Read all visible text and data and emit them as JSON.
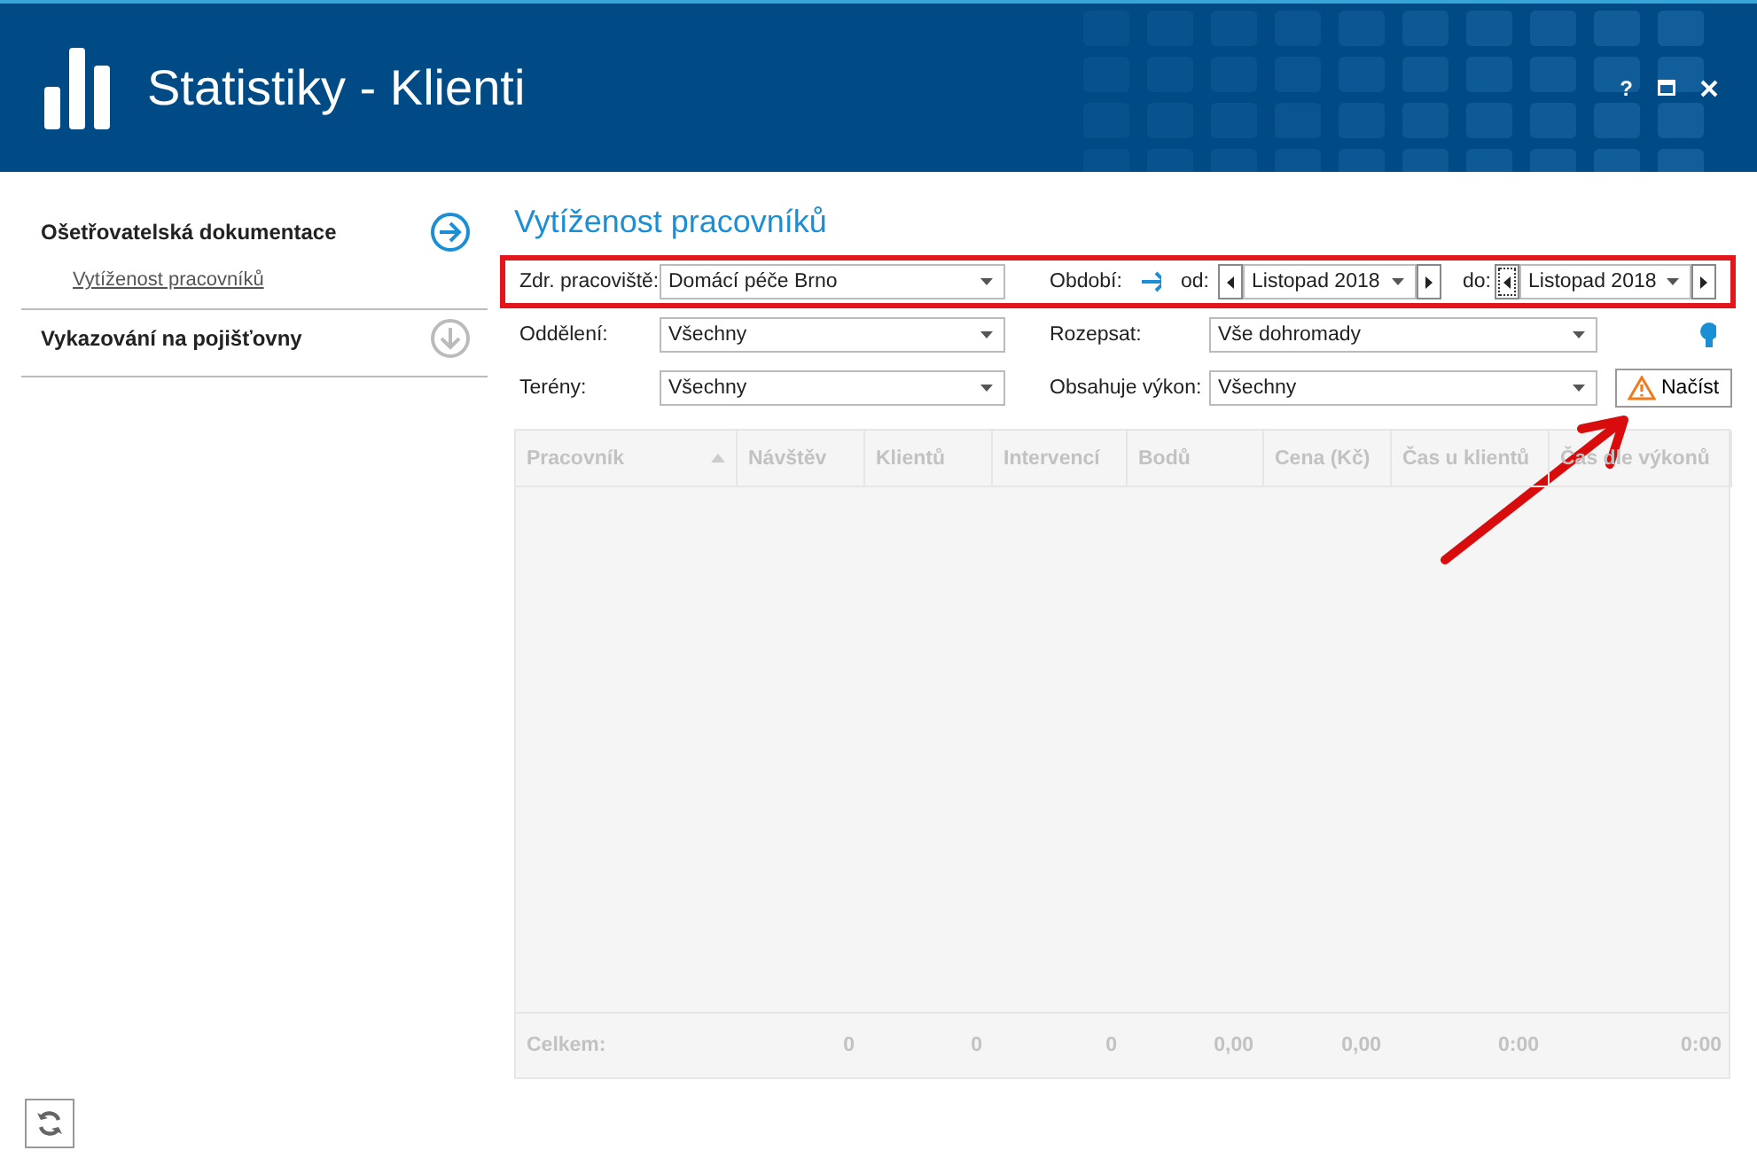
{
  "window": {
    "title": "Statistiky - Klienti",
    "help": "?"
  },
  "sidebar": {
    "sections": [
      {
        "title": "Ošetřovatelská dokumentace",
        "active": true,
        "items": [
          {
            "label": "Vytíženost pracovníků"
          }
        ]
      },
      {
        "title": "Vykazování na pojišťovny",
        "active": false
      }
    ]
  },
  "page_title": "Vytíženost pracovníků",
  "filter_rows": [
    {
      "highlighted": true,
      "fields": [
        {
          "kind": "select",
          "label": "Zdr. pracoviště:",
          "value": "Domácí péče Brno"
        },
        {
          "kind": "period",
          "label": "Období:",
          "from_label": "od:",
          "from_value": "Listopad 2018",
          "to_label": "do:",
          "to_value": "Listopad 2018"
        }
      ]
    },
    {
      "highlighted": false,
      "fields": [
        {
          "kind": "select",
          "label": "Oddělení:",
          "value": "Všechny"
        },
        {
          "kind": "select",
          "label": "Rozepsat:",
          "value": "Vše dohromady"
        }
      ],
      "action": {
        "kind": "hint"
      }
    },
    {
      "highlighted": false,
      "fields": [
        {
          "kind": "select",
          "label": "Terény:",
          "value": "Všechny"
        },
        {
          "kind": "select",
          "label": "Obsahuje výkon:",
          "value": "Všechny"
        }
      ],
      "action": {
        "kind": "button",
        "label": "Načíst"
      }
    }
  ],
  "table": {
    "columns": [
      {
        "label": "Pracovník",
        "sorted": true
      },
      {
        "label": "Návštěv",
        "sorted": false
      },
      {
        "label": "Klientů",
        "sorted": false
      },
      {
        "label": "Intervencí",
        "sorted": false
      },
      {
        "label": "Bodů",
        "sorted": false
      },
      {
        "label": "Cena (Kč)",
        "sorted": false
      },
      {
        "label": "Čas u klientů",
        "sorted": false
      },
      {
        "label": "Čas dle výkonů",
        "sorted": false
      }
    ],
    "totals": [
      "Celkem:",
      "0",
      "0",
      "0",
      "0,00",
      "0,00",
      "0:00",
      "0:00"
    ]
  }
}
